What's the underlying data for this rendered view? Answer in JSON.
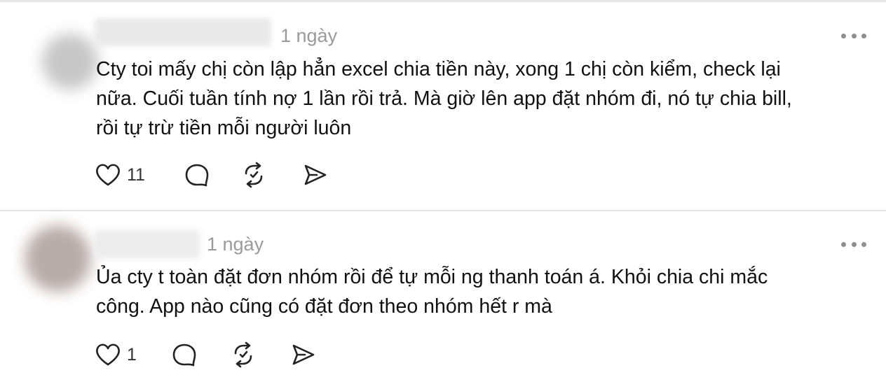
{
  "comments": [
    {
      "time": "1 ngày",
      "text": "Cty toi mấy chị còn lập hẳn excel chia tiền này, xong 1 chị còn kiểm, check lại\nnữa. Cuối tuần tính nợ 1 lần rồi trả. Mà giờ lên app đặt nhóm đi, nó tự chia bill,\nrồi tự trừ tiền mỗi người luôn",
      "likes": "11",
      "icons": [
        "heart-icon",
        "comment-icon",
        "repost-icon",
        "share-icon",
        "more-icon"
      ]
    },
    {
      "time": "1 ngày",
      "text": "Ủa cty t toàn đặt đơn nhóm rồi để tự mỗi ng thanh toán á. Khỏi chia chi mắc\ncông. App nào cũng có đặt đơn theo nhóm hết r mà",
      "likes": "1",
      "icons": [
        "heart-icon",
        "comment-icon",
        "repost-icon",
        "share-icon",
        "more-icon"
      ]
    }
  ]
}
